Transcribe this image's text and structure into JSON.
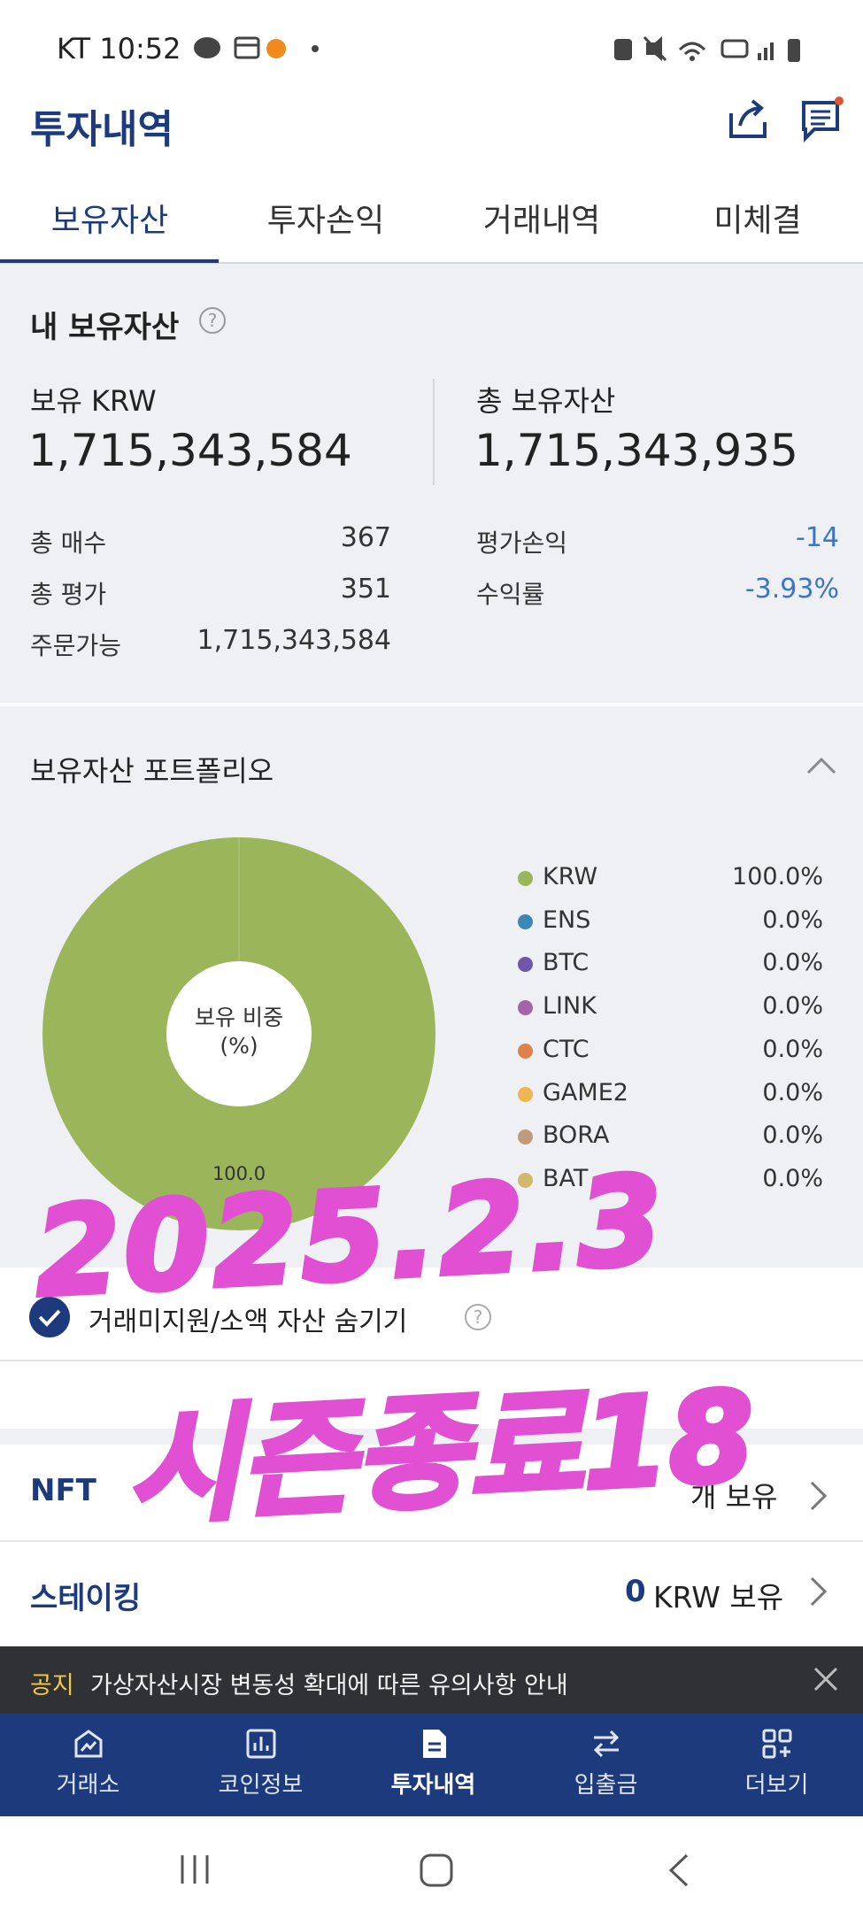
{
  "status_bar": {
    "carrier_time": "KT 10:52"
  },
  "header": {
    "title": "투자내역",
    "share_icon": "share-icon",
    "chat_icon": "chat-icon"
  },
  "tabs": [
    {
      "label": "보유자산",
      "active": true
    },
    {
      "label": "투자손익",
      "active": false
    },
    {
      "label": "거래내역",
      "active": false
    },
    {
      "label": "미체결",
      "active": false
    }
  ],
  "holdings": {
    "section_title": "내 보유자산",
    "krw_label": "보유 KRW",
    "krw_value": "1,715,343,584",
    "total_label": "총 보유자산",
    "total_value": "1,715,343,935",
    "rows_left": [
      {
        "label": "총 매수",
        "value": "367"
      },
      {
        "label": "총 평가",
        "value": "351"
      },
      {
        "label": "주문가능",
        "value": "1,715,343,584"
      }
    ],
    "rows_right": [
      {
        "label": "평가손익",
        "value": "-14"
      },
      {
        "label": "수익률",
        "value": "-3.93%"
      }
    ]
  },
  "portfolio": {
    "title": "보유자산 포트폴리오",
    "donut_center_line1": "보유 비중",
    "donut_center_line2": "(%)",
    "legend": [
      {
        "name": "KRW",
        "value": "100.0%",
        "color": "#9bb55a"
      },
      {
        "name": "ENS",
        "value": "0.0%",
        "color": "#3c88b4"
      },
      {
        "name": "BTC",
        "value": "0.0%",
        "color": "#6c57a8"
      },
      {
        "name": "LINK",
        "value": "0.0%",
        "color": "#a664a8"
      },
      {
        "name": "CTC",
        "value": "0.0%",
        "color": "#e0804a"
      },
      {
        "name": "GAME2",
        "value": "0.0%",
        "color": "#f0b553"
      },
      {
        "name": "BORA",
        "value": "0.0%",
        "color": "#c09a7a"
      },
      {
        "name": "BAT",
        "value": "0.0%",
        "color": "#d2b86a"
      }
    ]
  },
  "chart_data": {
    "type": "pie",
    "categories": [
      "KRW",
      "ENS",
      "BTC",
      "LINK",
      "CTC",
      "GAME2",
      "BORA",
      "BAT"
    ],
    "values": [
      100.0,
      0.0,
      0.0,
      0.0,
      0.0,
      0.0,
      0.0,
      0.0
    ],
    "data_labels": [
      "100.0"
    ],
    "title": "보유자산 포트폴리오",
    "legend": "right"
  },
  "hide_small": {
    "label": "거래미지원/소액 자산 숨기기",
    "checked": true
  },
  "nft": {
    "title": "NFT",
    "value_suffix": "개 보유"
  },
  "staking": {
    "title": "스테이킹",
    "amount": "0",
    "unit": "KRW 보유"
  },
  "notice": {
    "tag": "공지",
    "text": "가상자산시장 변동성 확대에 따른 유의사항 안내"
  },
  "bottom_nav": [
    {
      "label": "거래소",
      "icon": "exchange-icon",
      "active": false
    },
    {
      "label": "코인정보",
      "icon": "chart-icon",
      "active": false
    },
    {
      "label": "투자내역",
      "icon": "document-icon",
      "active": true
    },
    {
      "label": "입출금",
      "icon": "transfer-icon",
      "active": false
    },
    {
      "label": "더보기",
      "icon": "more-grid-icon",
      "active": false
    }
  ],
  "handwriting": {
    "line1": "2025.2.3",
    "line2": "시즌종료18"
  }
}
